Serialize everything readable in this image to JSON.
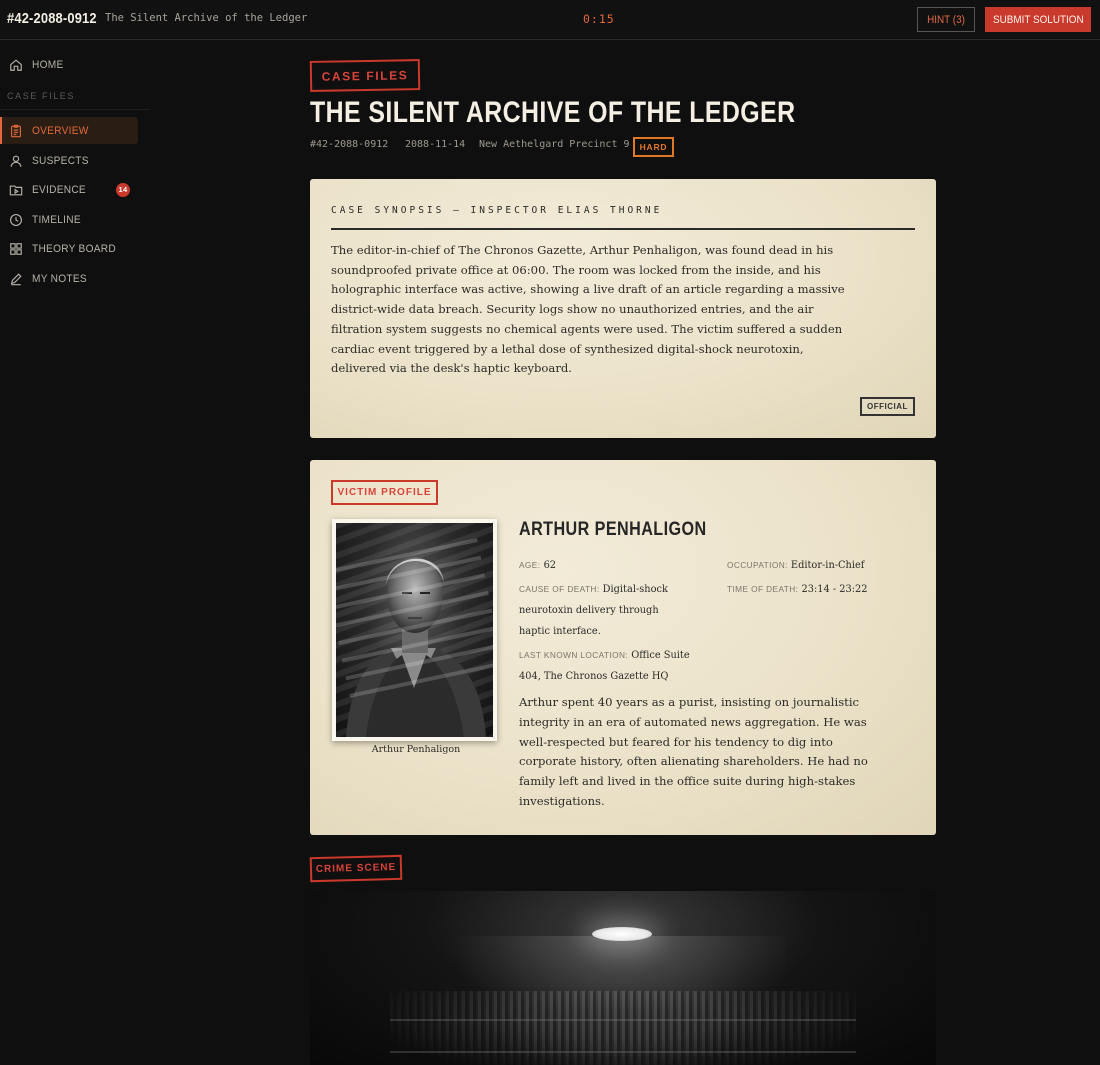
{
  "topbar": {
    "case_id": "#42-2088-0912",
    "case_title": "The Silent Archive of the Ledger",
    "timer": "0:15",
    "hint_label": "HINT (3)",
    "submit_label": "SUBMIT SOLUTION"
  },
  "sidebar": {
    "home": {
      "label": "HOME",
      "icon": "home-icon"
    },
    "section_label": "CASE FILES",
    "items": [
      {
        "label": "OVERVIEW",
        "icon": "clipboard-icon",
        "active": true
      },
      {
        "label": "SUSPECTS",
        "icon": "user-icon"
      },
      {
        "label": "EVIDENCE",
        "icon": "folder-play-icon",
        "badge": "14"
      },
      {
        "label": "TIMELINE",
        "icon": "clock-icon"
      },
      {
        "label": "THEORY BOARD",
        "icon": "grid-icon"
      },
      {
        "label": "MY NOTES",
        "icon": "pencil-icon"
      }
    ],
    "active_color": "#e0683a"
  },
  "header": {
    "stamp": "CASE FILES",
    "title": "THE SILENT ARCHIVE OF THE LEDGER",
    "case_number": "#42-2088-0912",
    "date": "2088-11-14",
    "location": "New Aethelgard Precinct 9",
    "difficulty": "HARD"
  },
  "synopsis": {
    "heading": "CASE SYNOPSIS — INSPECTOR ELIAS THORNE",
    "lines": [
      "The editor-in-chief of The Chronos Gazette, Arthur Penhaligon, was found dead in his",
      "soundproofed private office at 06:00. The room was locked from the inside, and his",
      "holographic interface was active, showing a live draft of an article regarding a massive",
      "district-wide data breach. Security logs show no unauthorized entries, and the air",
      "filtration system suggests no chemical agents were used. The victim suffered a sudden",
      "cardiac event triggered by a lethal dose of synthesized digital-shock neurotoxin,",
      "delivered via the desk's haptic keyboard."
    ],
    "stamp": "OFFICIAL"
  },
  "victim": {
    "stamp": "VICTIM PROFILE",
    "name": "ARTHUR PENHALIGON",
    "photo_caption": "Arthur Penhaligon",
    "age_label": "AGE:",
    "age": "62",
    "occupation_label": "OCCUPATION:",
    "occupation": "Editor-in-Chief",
    "cause_label": "CAUSE OF DEATH:",
    "cause_lines": [
      "Digital-shock",
      "neurotoxin delivery through",
      "haptic interface."
    ],
    "tod_label": "TIME OF DEATH:",
    "tod": "23:14 - 23:22",
    "location_label": "LAST KNOWN LOCATION:",
    "location_lines": [
      "Office Suite",
      "404, The Chronos Gazette HQ"
    ],
    "bio_lines": [
      "Arthur spent 40 years as a purist, insisting on journalistic",
      "integrity in an era of automated news aggregation. He was",
      "well-respected but feared for his tendency to dig into",
      "corporate history, often alienating shareholders. He had no",
      "family left and lived in the office suite during high-stakes",
      "investigations."
    ]
  },
  "crime_scene": {
    "stamp": "CRIME SCENE"
  },
  "colors": {
    "accent_red": "#c9392c",
    "accent_orange": "#e0683a",
    "paper": "#ede4cc",
    "background": "#0f0f0f"
  }
}
